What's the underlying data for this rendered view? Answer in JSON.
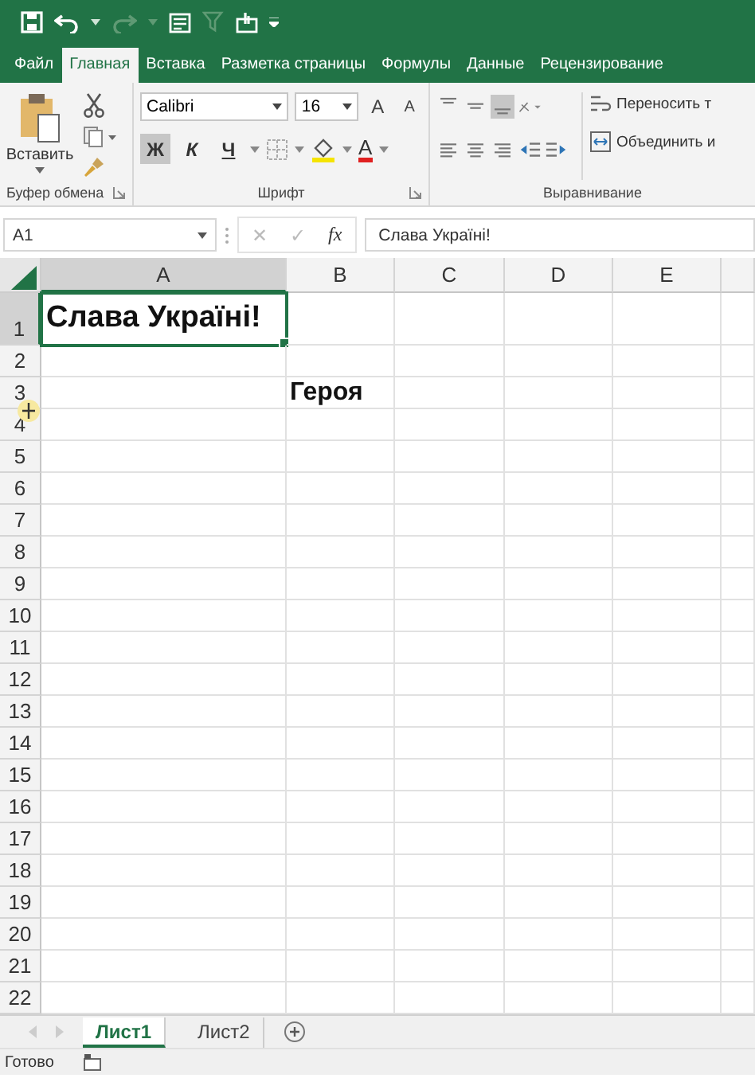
{
  "tabs": [
    {
      "label": "Файл",
      "selected": false
    },
    {
      "label": "Главная",
      "selected": true
    },
    {
      "label": "Вставка",
      "selected": false
    },
    {
      "label": "Разметка страницы",
      "selected": false
    },
    {
      "label": "Формулы",
      "selected": false
    },
    {
      "label": "Данные",
      "selected": false
    },
    {
      "label": "Рецензирование",
      "selected": false
    }
  ],
  "ribbon": {
    "clipboard": {
      "paste_label": "Вставить",
      "group_label": "Буфер обмена"
    },
    "font": {
      "font_name": "Calibri",
      "font_size": "16",
      "grow_glyph": "A",
      "shrink_glyph": "A",
      "format_buttons": [
        {
          "label": "Ж",
          "on": true
        },
        {
          "label": "К",
          "on": false
        },
        {
          "label": "Ч",
          "on": false
        }
      ],
      "font_color_glyph": "A",
      "group_label": "Шрифт"
    },
    "alignment": {
      "wrap_label": "Переносить т",
      "merge_label": "Объединить и",
      "group_label": "Выравнивание"
    }
  },
  "formula_bar": {
    "name_box": "A1",
    "cancel": "✕",
    "enter": "✓",
    "fx": "fx",
    "formula": "Слава Україні!"
  },
  "columns": [
    {
      "label": "A",
      "selected": true
    },
    {
      "label": "B",
      "selected": false
    },
    {
      "label": "C",
      "selected": false
    },
    {
      "label": "D",
      "selected": false
    },
    {
      "label": "E",
      "selected": false
    }
  ],
  "rows": [
    {
      "label": "1",
      "selected": true,
      "column_a": "Слава Україні!"
    },
    {
      "label": "2",
      "selected": false
    },
    {
      "label": "3",
      "selected": false,
      "column_b": "Героя"
    },
    {
      "label": "4",
      "selected": false
    },
    {
      "label": "5",
      "selected": false
    },
    {
      "label": "6",
      "selected": false
    },
    {
      "label": "7",
      "selected": false
    },
    {
      "label": "8",
      "selected": false
    },
    {
      "label": "9",
      "selected": false
    },
    {
      "label": "10",
      "selected": false
    },
    {
      "label": "11",
      "selected": false
    },
    {
      "label": "12",
      "selected": false
    },
    {
      "label": "13",
      "selected": false
    },
    {
      "label": "14",
      "selected": false
    },
    {
      "label": "15",
      "selected": false
    },
    {
      "label": "16",
      "selected": false
    },
    {
      "label": "17",
      "selected": false
    },
    {
      "label": "18",
      "selected": false
    },
    {
      "label": "19",
      "selected": false
    },
    {
      "label": "20",
      "selected": false
    },
    {
      "label": "21",
      "selected": false
    },
    {
      "label": "22",
      "selected": false
    }
  ],
  "sheets": [
    {
      "label": "Лист1",
      "selected": true
    },
    {
      "label": "Лист2",
      "selected": false
    }
  ],
  "status_bar": {
    "text": "Готово"
  }
}
